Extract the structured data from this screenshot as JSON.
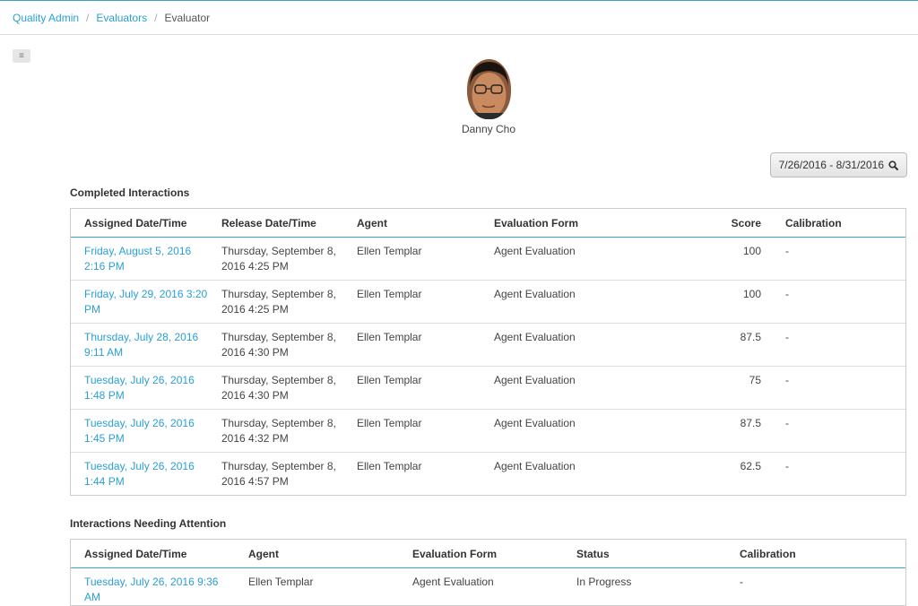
{
  "breadcrumb": {
    "items": [
      {
        "label": "Quality Admin"
      },
      {
        "label": "Evaluators"
      }
    ],
    "current": "Evaluator",
    "separator": "/"
  },
  "menu_toggle": {
    "icon": "hamburger-icon"
  },
  "profile": {
    "name": "Danny Cho"
  },
  "date_range": {
    "label": "7/26/2016 - 8/31/2016",
    "icon": "search-icon"
  },
  "completed": {
    "title": "Completed Interactions",
    "columns": [
      "Assigned Date/Time",
      "Release Date/Time",
      "Agent",
      "Evaluation Form",
      "Score",
      "Calibration"
    ],
    "rows": [
      {
        "assigned": "Friday, August 5, 2016 2:16 PM",
        "release": "Thursday, September 8, 2016 4:25 PM",
        "agent": "Ellen Templar",
        "form": "Agent Evaluation",
        "score": "100",
        "calibration": "-"
      },
      {
        "assigned": "Friday, July 29, 2016 3:20 PM",
        "release": "Thursday, September 8, 2016 4:25 PM",
        "agent": "Ellen Templar",
        "form": "Agent Evaluation",
        "score": "100",
        "calibration": "-"
      },
      {
        "assigned": "Thursday, July 28, 2016 9:11 AM",
        "release": "Thursday, September 8, 2016 4:30 PM",
        "agent": "Ellen Templar",
        "form": "Agent Evaluation",
        "score": "87.5",
        "calibration": "-"
      },
      {
        "assigned": "Tuesday, July 26, 2016 1:48 PM",
        "release": "Thursday, September 8, 2016 4:30 PM",
        "agent": "Ellen Templar",
        "form": "Agent Evaluation",
        "score": "75",
        "calibration": "-"
      },
      {
        "assigned": "Tuesday, July 26, 2016 1:45 PM",
        "release": "Thursday, September 8, 2016 4:32 PM",
        "agent": "Ellen Templar",
        "form": "Agent Evaluation",
        "score": "87.5",
        "calibration": "-"
      },
      {
        "assigned": "Tuesday, July 26, 2016 1:44 PM",
        "release": "Thursday, September 8, 2016 4:57 PM",
        "agent": "Ellen Templar",
        "form": "Agent Evaluation",
        "score": "62.5",
        "calibration": "-"
      }
    ]
  },
  "attention": {
    "title": "Interactions Needing Attention",
    "columns": [
      "Assigned Date/Time",
      "Agent",
      "Evaluation Form",
      "Status",
      "Calibration"
    ],
    "rows": [
      {
        "assigned": "Tuesday, July 26, 2016 9:36 AM",
        "agent": "Ellen Templar",
        "form": "Agent Evaluation",
        "status": "In Progress",
        "calibration": "-"
      }
    ]
  },
  "colors": {
    "accent": "#2a9fd6",
    "header_rule": "#3ba3c7"
  }
}
